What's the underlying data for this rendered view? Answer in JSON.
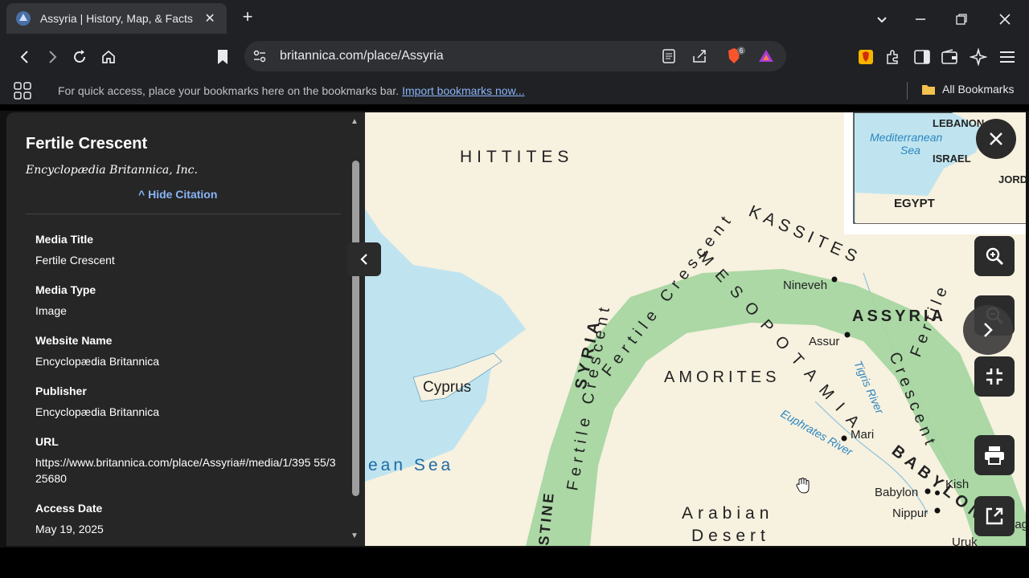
{
  "tab": {
    "title": "Assyria | History, Map, & Facts |"
  },
  "omnibox": {
    "url": "britannica.com/place/Assyria",
    "brave_badge": "6"
  },
  "bookmarks_bar": {
    "message": "For quick access, place your bookmarks here on the bookmarks bar.",
    "import_link": "Import bookmarks now...",
    "all_bookmarks": "All Bookmarks"
  },
  "citation": {
    "title": "Fertile Crescent",
    "publisher": "Encyclopædia Britannica, Inc.",
    "hide_label": "Hide Citation",
    "fields": [
      {
        "label": "Media Title",
        "value": "Fertile Crescent"
      },
      {
        "label": "Media Type",
        "value": "Image"
      },
      {
        "label": "Website Name",
        "value": "Encyclopædia Britannica"
      },
      {
        "label": "Publisher",
        "value": "Encyclopædia Britannica"
      },
      {
        "label": "URL",
        "value": "https://www.britannica.com/place/Assyria#/media/1/395 55/325680"
      },
      {
        "label": "Access Date",
        "value": "May 19, 2025"
      }
    ]
  },
  "map": {
    "labels": {
      "hittites": "HITTITES",
      "kassites": "KASSITES",
      "mesopotamia": "MESOPOTAMIA",
      "assyria": "ASSYRIA",
      "amorites": "AMORITES",
      "syria": "SYRIA",
      "fertile_crescent_1": "Fertile Crescent",
      "fertile_crescent_2": "Fertile",
      "fertile_crescent_3": "Crescent",
      "babylonia": "BABYLONIA",
      "arabian": "Arabian",
      "desert": "Desert",
      "cyprus": "Cyprus",
      "sea": "ean Sea",
      "palestine": "STINE",
      "nineveh": "Nineveh",
      "assur": "Assur",
      "mari": "Mari",
      "babylon": "Babylon",
      "kish": "Kish",
      "nippur": "Nippur",
      "uruk": "Uruk",
      "lagash": "Laga",
      "tigris": "Tigris River",
      "euphrates": "Euphrates River"
    },
    "inset": {
      "lebanon": "LEBANON",
      "med_1": "Mediterranean",
      "med_2": "Sea",
      "israel": "ISRAEL",
      "jordan": "JORD",
      "egypt": "EGYPT"
    }
  }
}
